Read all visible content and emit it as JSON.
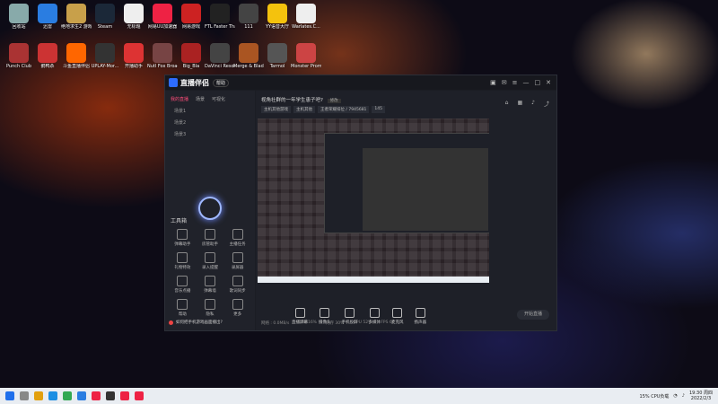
{
  "desktop_icons": [
    {
      "label": "回收站",
      "color": "#8aa"
    },
    {
      "label": "迅雷",
      "color": "#2a7de1"
    },
    {
      "label": "绝地求生2 游戏列表",
      "color": "#c8a04a"
    },
    {
      "label": "Steam",
      "color": "#1b2838"
    },
    {
      "label": "无标题",
      "color": "#eee"
    },
    {
      "label": "网易UU加速器",
      "color": "#e24"
    },
    {
      "label": "网易游戏",
      "color": "#c22"
    },
    {
      "label": "FTL Faster Than Light",
      "color": "#222"
    },
    {
      "label": "111",
      "color": "#444"
    },
    {
      "label": "YY语音大厅",
      "color": "#f4c20d"
    },
    {
      "label": "Warlates.C...",
      "color": "#eee"
    },
    {
      "label": "Punch Club",
      "color": "#a33"
    },
    {
      "label": "鹅鸭杀",
      "color": "#c33"
    },
    {
      "label": "斗鱼直播伴侣",
      "color": "#f60"
    },
    {
      "label": "UPLAY-Mor...",
      "color": "#333"
    },
    {
      "label": "开播助手",
      "color": "#d33"
    },
    {
      "label": "Nutl Fox Broadcast",
      "color": "#744"
    },
    {
      "label": "Big_Bla",
      "color": "#a22"
    },
    {
      "label": "DaVinci Resolve",
      "color": "#444"
    },
    {
      "label": "Merge & Blade",
      "color": "#a52"
    },
    {
      "label": "Tarmol",
      "color": "#555"
    },
    {
      "label": "Monster Prom",
      "color": "#c44"
    }
  ],
  "app": {
    "logo": "直播伴侣",
    "version": "帮助",
    "left_tabs": [
      "我的直播",
      "场景",
      "可视化"
    ],
    "scenes": [
      "场景1",
      "场景2",
      "场景3"
    ],
    "tool_title": "工具箱",
    "tools": [
      "弹幕助手",
      "房管助手",
      "主播任务",
      "礼物特效",
      "录入提醒",
      "录屏器",
      "音乐点播",
      "弹幕墙",
      "歌词同步",
      "帮助",
      "隐私",
      "更多"
    ],
    "bottom_message": "如何把手机游戏画面播出?",
    "room_title": "视角社群的一年学生患子吧?",
    "room_edit": "修改",
    "tags": [
      "主机其他游戏",
      "主机其他",
      "王者荣耀排位 / 7945681",
      "145"
    ],
    "bottom_tools": [
      "直播屏幕",
      "摄像头",
      "手机投屏",
      "多媒体",
      "麦克风",
      "扬声器"
    ],
    "start_button": "开始直播",
    "status": [
      "网络 : 0.0MB/s",
      "CPU 16%",
      "内存 30%",
      "GPU 52%",
      "FPS 60"
    ]
  },
  "taskbar": {
    "cpu": "15% CPU负载",
    "time": "19:30 周四",
    "date": "2022/2/3"
  }
}
